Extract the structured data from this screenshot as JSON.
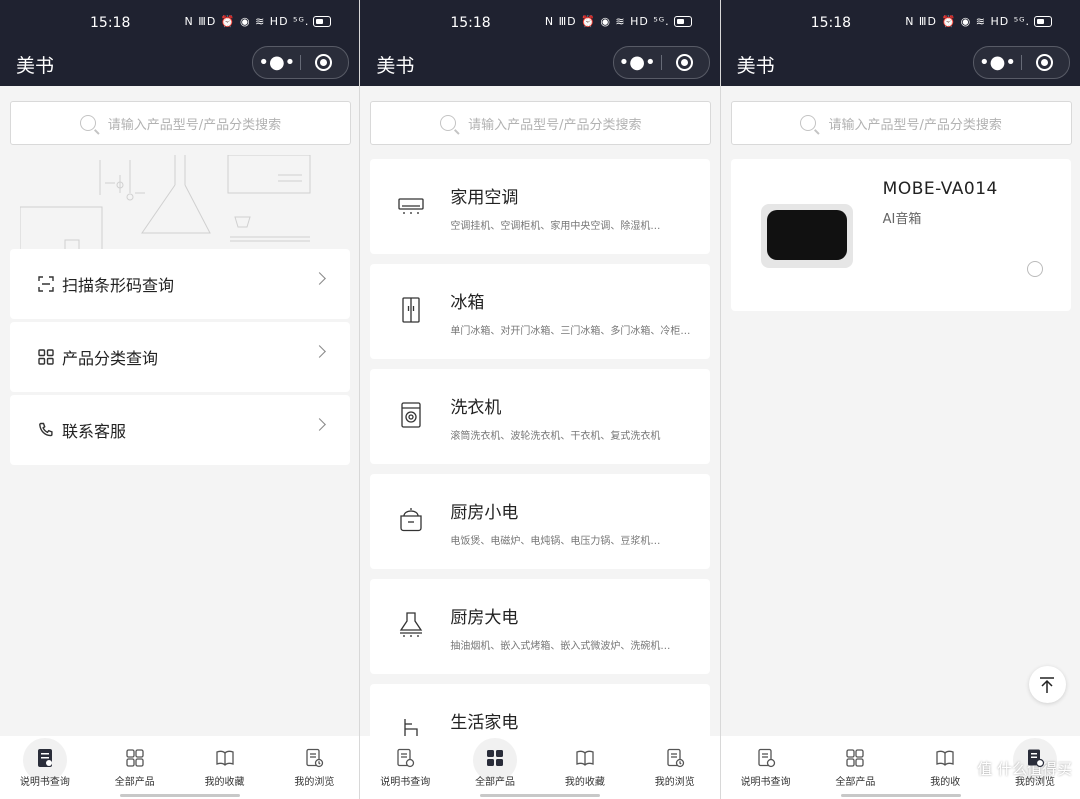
{
  "status": {
    "time": "15:18",
    "indicators": "N ⅢD ⏰ ◉ ≋ HD ⁵ᴳ."
  },
  "app": {
    "title": "美书"
  },
  "search": {
    "placeholder": "请输入产品型号/产品分类搜索"
  },
  "screen1": {
    "menu": [
      {
        "label": "扫描条形码查询",
        "icon": "scan-icon"
      },
      {
        "label": "产品分类查询",
        "icon": "grid-icon"
      },
      {
        "label": "联系客服",
        "icon": "phone-icon"
      }
    ]
  },
  "screen2": {
    "categories": [
      {
        "title": "家用空调",
        "sub": "空调挂机、空调柜机、家用中央空调、除湿机…",
        "icon": "air-conditioner-icon"
      },
      {
        "title": "冰箱",
        "sub": "单门冰箱、对开门冰箱、三门冰箱、多门冰箱、冷柜…",
        "icon": "fridge-icon"
      },
      {
        "title": "洗衣机",
        "sub": "滚筒洗衣机、波轮洗衣机、干衣机、复式洗衣机",
        "icon": "washing-machine-icon"
      },
      {
        "title": "厨房小电",
        "sub": "电饭煲、电磁炉、电炖锅、电压力锅、豆浆机…",
        "icon": "rice-cooker-icon"
      },
      {
        "title": "厨房大电",
        "sub": "抽油烟机、嵌入式烤箱、嵌入式微波炉、洗碗机…",
        "icon": "range-hood-icon"
      },
      {
        "title": "生活家电",
        "sub": "",
        "icon": "chair-icon"
      }
    ]
  },
  "screen3": {
    "product": {
      "model": "MOBE-VA014",
      "type": "AI音箱"
    }
  },
  "tabs": [
    {
      "label": "说明书查询",
      "icon": "manual-icon"
    },
    {
      "label": "全部产品",
      "icon": "grid-icon"
    },
    {
      "label": "我的收藏",
      "icon": "book-icon"
    },
    {
      "label": "我的浏览",
      "icon": "history-icon"
    }
  ],
  "tabs3": [
    "说明书查询",
    "全部产品",
    "我的收",
    "我的浏览"
  ],
  "watermark": "值 什么值得买",
  "colors": {
    "header": "#1f2230",
    "background": "#f4f4f4",
    "card": "#ffffff"
  }
}
